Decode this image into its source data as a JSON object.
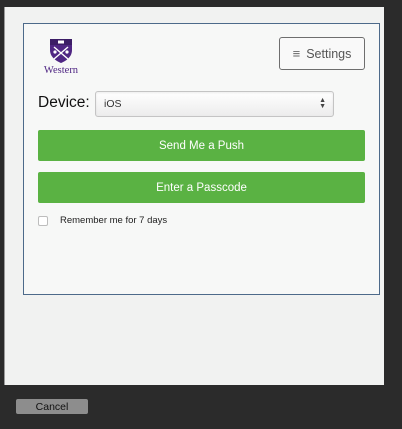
{
  "logo": {
    "text": "Western",
    "icon": "western-crest-icon",
    "color": "#4f2683"
  },
  "settings": {
    "label": "Settings",
    "icon": "hamburger-menu-icon"
  },
  "device": {
    "label": "Device:",
    "selected": "iOS"
  },
  "actions": {
    "push_label": "Send Me a Push",
    "passcode_label": "Enter a Passcode",
    "color": "#5ab243"
  },
  "remember": {
    "label": "Remember me for 7 days",
    "checked": false
  },
  "footer": {
    "cancel_label": "Cancel"
  }
}
